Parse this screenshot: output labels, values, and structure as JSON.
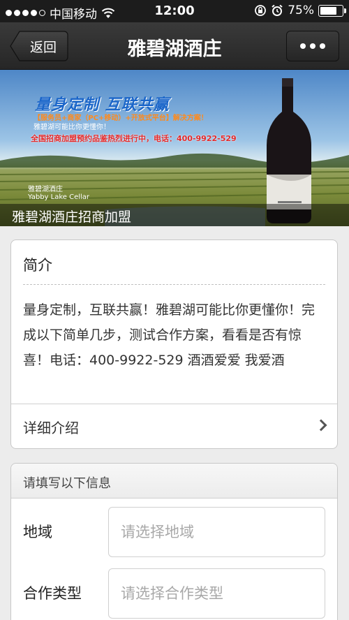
{
  "status_bar": {
    "carrier": "中国移动",
    "time": "12:00",
    "battery": "75%",
    "battery_level": 0.75
  },
  "nav": {
    "back_label": "返回",
    "title": "雅碧湖酒庄",
    "more_icon": "ellipsis-icon"
  },
  "banner": {
    "headline": "量身定制 互联共赢",
    "line1": "【服务员+商家（PC+移动）+开放式平台】解决方案！",
    "line2": "雅碧湖可能比你更懂你！",
    "line3": "全国招商加盟预约品鉴热烈进行中，电话：400-9922-529",
    "logo_cn": "雅碧湖酒庄",
    "logo_en": "Yabby Lake Cellar",
    "caption": "雅碧湖酒庄招商加盟"
  },
  "intro": {
    "title": "简介",
    "text": "量身定制，互联共赢！雅碧湖可能比你更懂你！完成以下简单几步，测试合作方案，看看是否有惊喜！电话：400-9922-529 酒酒爱爱 我爱酒",
    "detail_label": "详细介绍"
  },
  "form": {
    "header": "请填写以下信息",
    "fields": [
      {
        "label": "地域",
        "placeholder": "请选择地域"
      },
      {
        "label": "合作类型",
        "placeholder": "请选择合作类型"
      }
    ]
  }
}
